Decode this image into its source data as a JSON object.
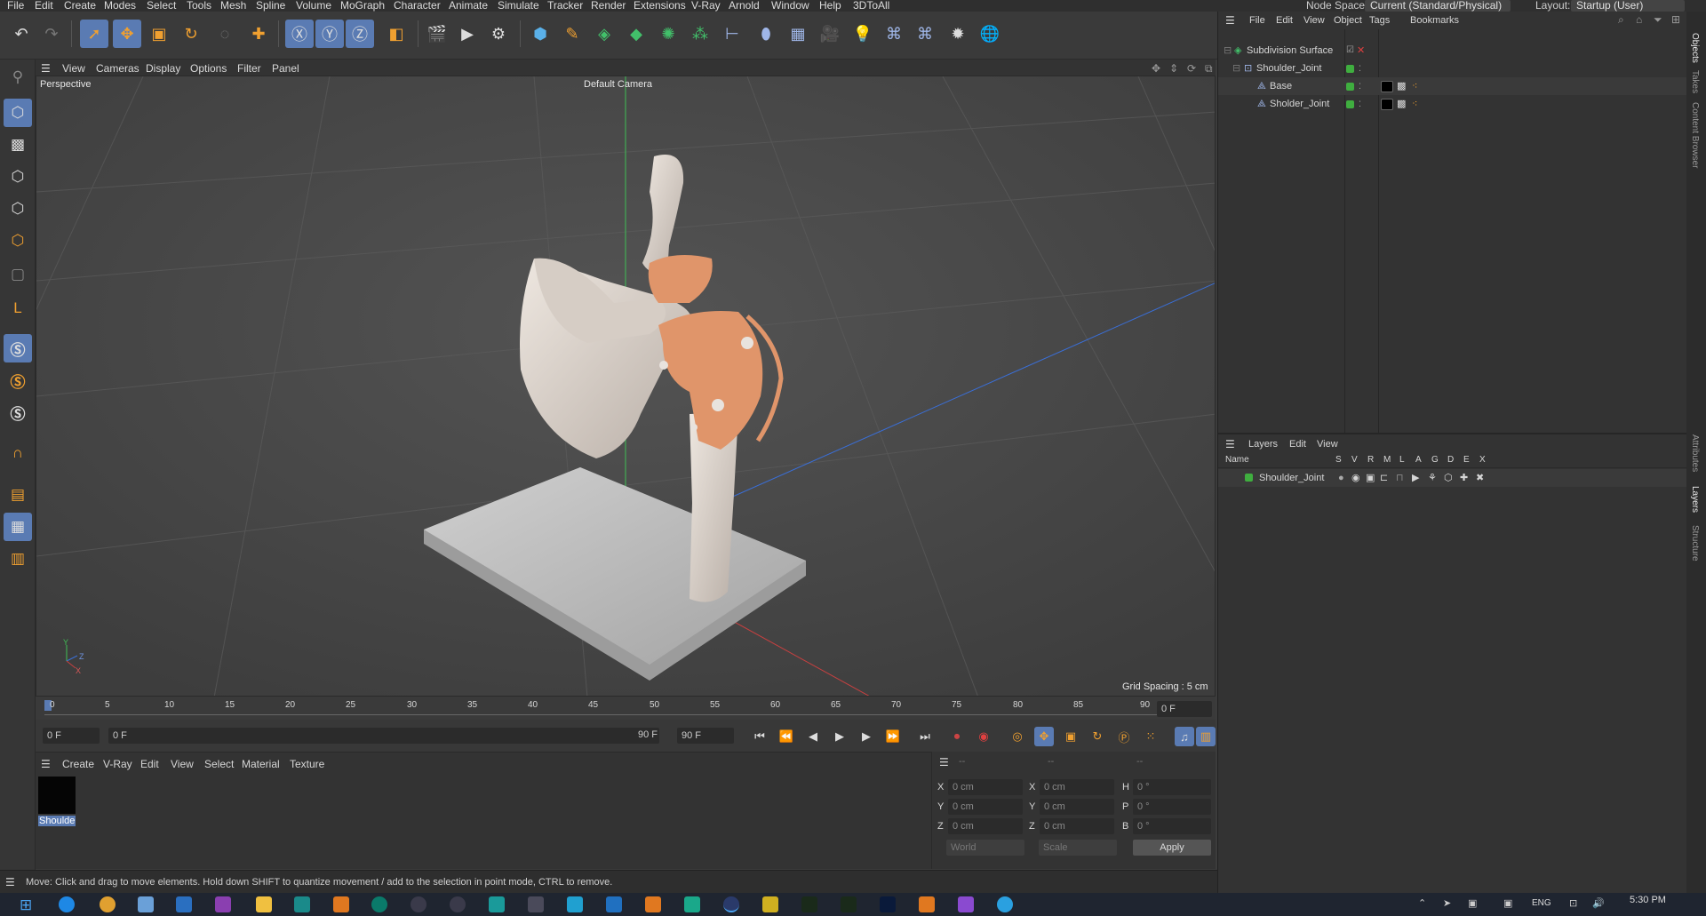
{
  "menubar": {
    "items": [
      "File",
      "Edit",
      "Create",
      "Modes",
      "Select",
      "Tools",
      "Mesh",
      "Spline",
      "Volume",
      "MoGraph",
      "Character",
      "Animate",
      "Simulate",
      "Tracker",
      "Render",
      "Extensions",
      "V-Ray",
      "Arnold",
      "Window",
      "Help",
      "3DToAll"
    ],
    "node_space_label": "Node Space:",
    "node_space_value": "Current (Standard/Physical)",
    "layout_label": "Layout:",
    "layout_value": "Startup (User)"
  },
  "viewport": {
    "menu": [
      "View",
      "Cameras",
      "Display",
      "Options",
      "Filter",
      "Panel"
    ],
    "projection": "Perspective",
    "camera": "Default Camera",
    "grid_spacing": "Grid Spacing : 5 cm",
    "axis_y": "Y",
    "axis_z": "Z",
    "axis_x": "X"
  },
  "timeline": {
    "ticks": [
      "0",
      "5",
      "10",
      "15",
      "20",
      "25",
      "30",
      "35",
      "40",
      "45",
      "50",
      "55",
      "60",
      "65",
      "70",
      "75",
      "80",
      "85",
      "90"
    ],
    "frame_right": "0 F",
    "current_start": "0 F",
    "range_start": "0 F",
    "range_end": "90 F",
    "end_frame": "90 F"
  },
  "material_panel": {
    "menu": [
      "Create",
      "V-Ray",
      "Edit",
      "View",
      "Select",
      "Material",
      "Texture"
    ],
    "material_name": "Shoulde"
  },
  "coord_panel": {
    "header": [
      "--",
      "--",
      "--"
    ],
    "rows": [
      {
        "a": "X",
        "av": "0 cm",
        "b": "X",
        "bv": "0 cm",
        "c": "H",
        "cv": "0 °"
      },
      {
        "a": "Y",
        "av": "0 cm",
        "b": "Y",
        "bv": "0 cm",
        "c": "P",
        "cv": "0 °"
      },
      {
        "a": "Z",
        "av": "0 cm",
        "b": "Z",
        "bv": "0 cm",
        "c": "B",
        "cv": "0 °"
      }
    ],
    "world": "World",
    "scale": "Scale",
    "apply": "Apply"
  },
  "status": {
    "text": "Move: Click and drag to move elements. Hold down SHIFT to quantize movement / add to the selection in point mode, CTRL to remove."
  },
  "objects_panel": {
    "menu": [
      "File",
      "Edit",
      "View",
      "Object",
      "Tags",
      "Bookmarks"
    ],
    "items": [
      {
        "name": "Subdivision Surface"
      },
      {
        "name": "Shoulder_Joint"
      },
      {
        "name": "Base"
      },
      {
        "name": "Sholder_Joint"
      }
    ]
  },
  "layers_panel": {
    "menu": [
      "Layers",
      "Edit",
      "View"
    ],
    "name_header": "Name",
    "cols": [
      "S",
      "V",
      "R",
      "M",
      "L",
      "A",
      "G",
      "D",
      "E",
      "X"
    ],
    "layer_name": "Shoulder_Joint"
  },
  "side_tabs": [
    "Objects",
    "Takes",
    "Content Browser",
    "Attributes",
    "Layers",
    "Structure"
  ],
  "taskbar": {
    "lang": "ENG",
    "time": "5:30 PM"
  },
  "colors": {
    "accent": "#5a7bb3",
    "bone": "#e2dad3",
    "cartilage": "#e0956a",
    "green": "#3fae3f"
  }
}
